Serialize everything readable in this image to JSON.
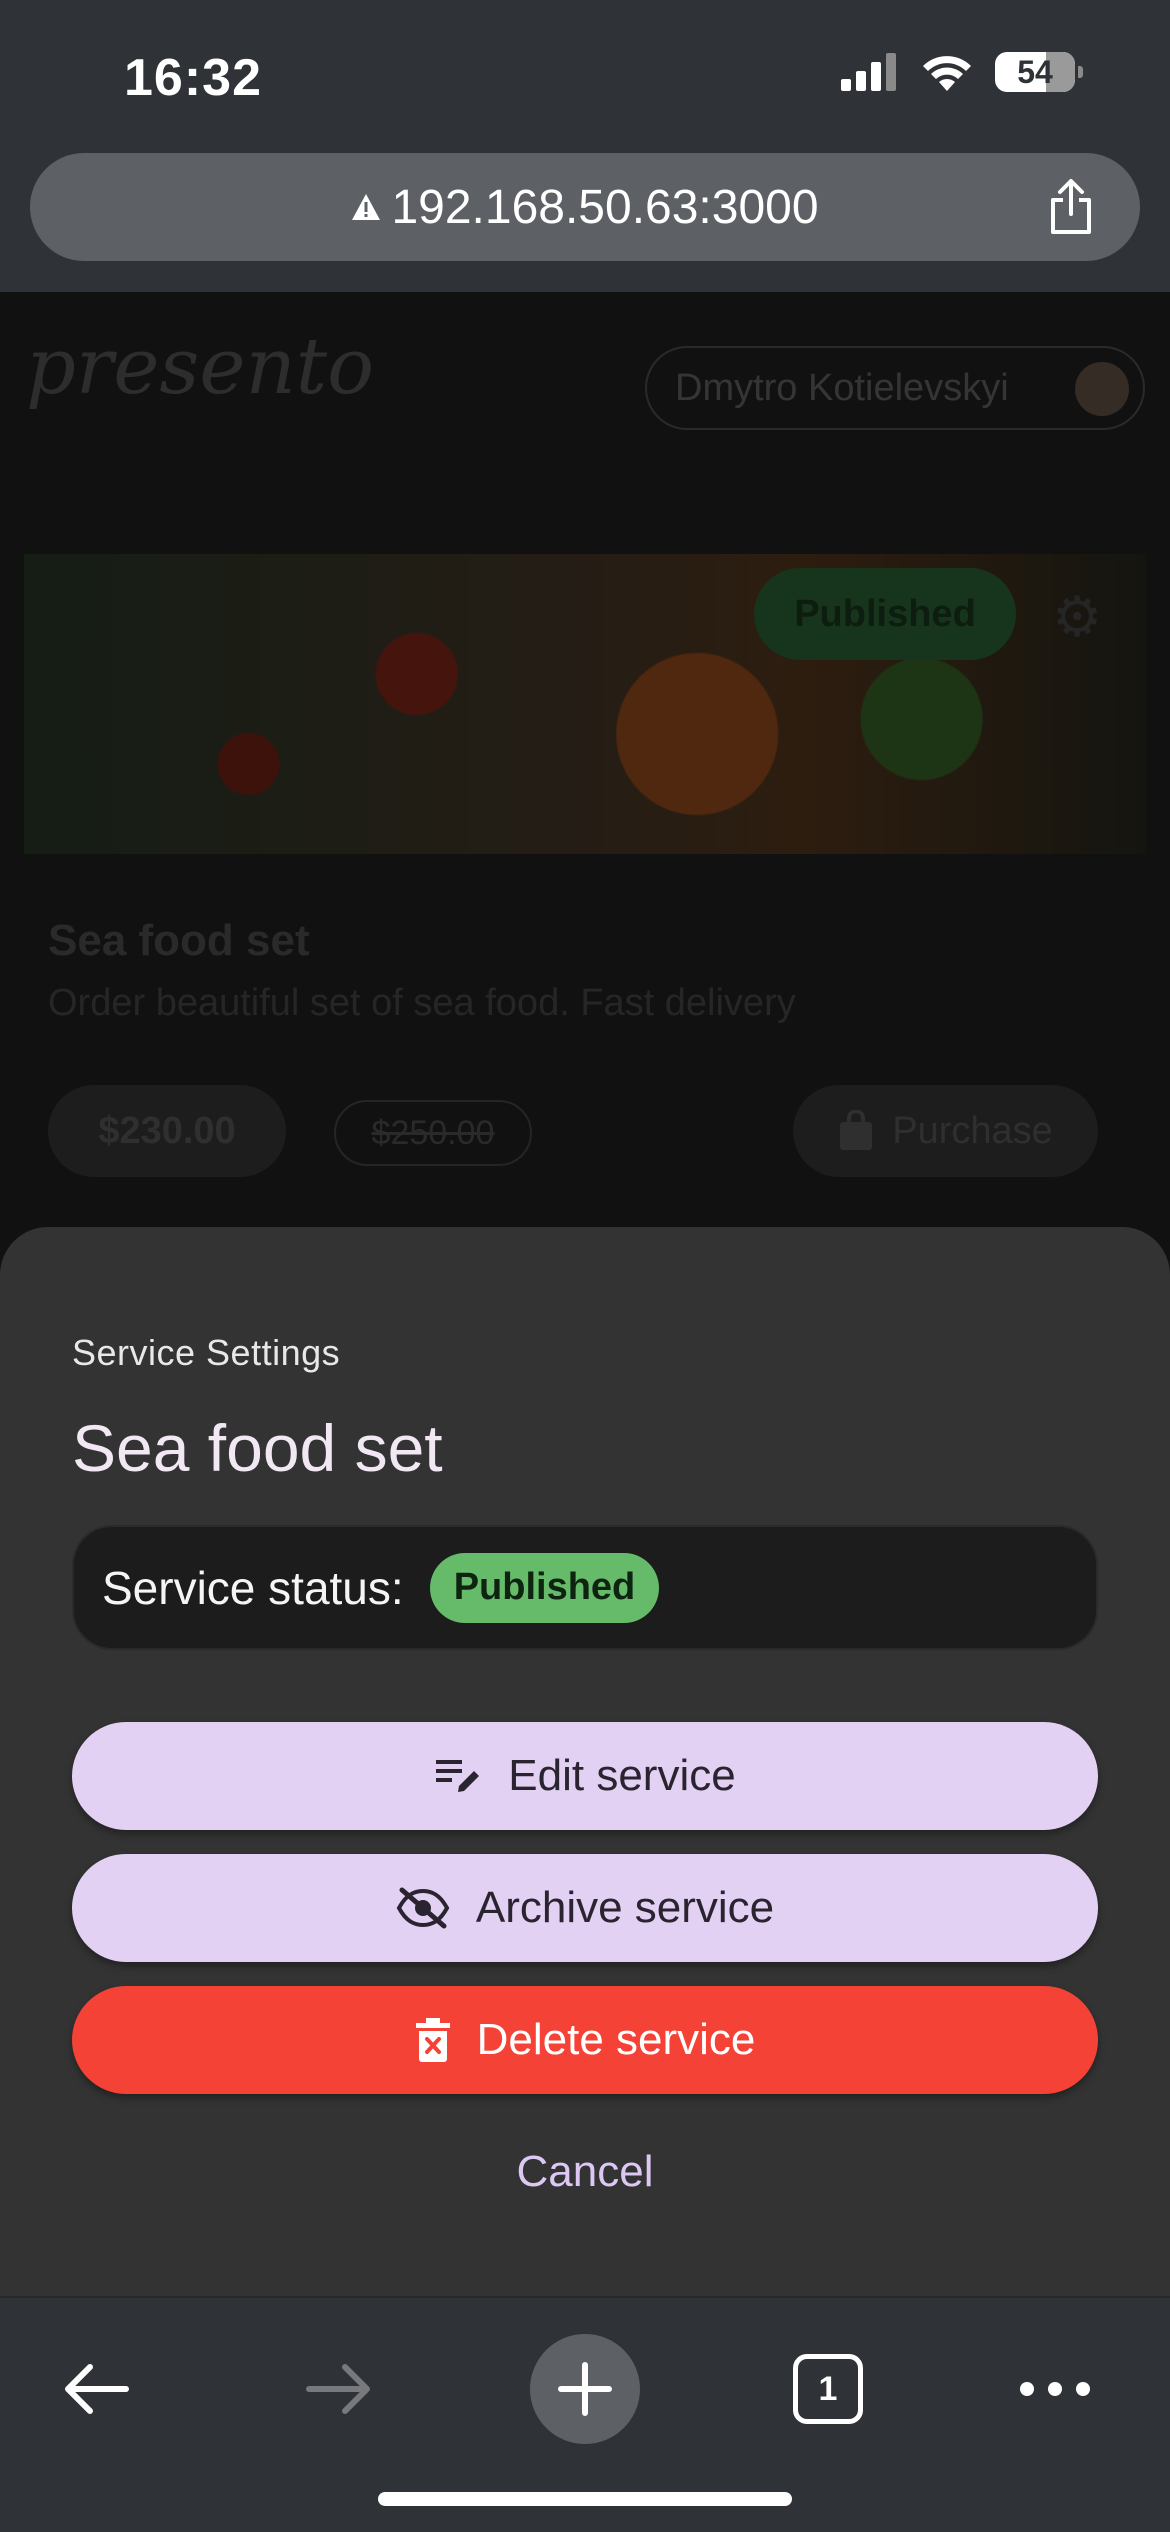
{
  "status_bar": {
    "time": "16:32",
    "battery": "54"
  },
  "browser": {
    "url": "192.168.50.63:3000",
    "tab_count": "1"
  },
  "page": {
    "logo": "presento",
    "user_name": "Dmytro Kotielevskyi",
    "card": {
      "badge": "Published",
      "title": "Sea food set",
      "description": "Order beautiful set of sea food. Fast delivery",
      "price": "$230.00",
      "old_price": "$250.00",
      "purchase_label": "Purchase"
    }
  },
  "sheet": {
    "overline": "Service Settings",
    "title": "Sea food set",
    "status_label": "Service status:",
    "status_value": "Published",
    "status_color": "#66bb6a",
    "edit_label": "Edit service",
    "archive_label": "Archive service",
    "delete_label": "Delete service",
    "delete_color": "#f44336",
    "cancel_label": "Cancel"
  }
}
